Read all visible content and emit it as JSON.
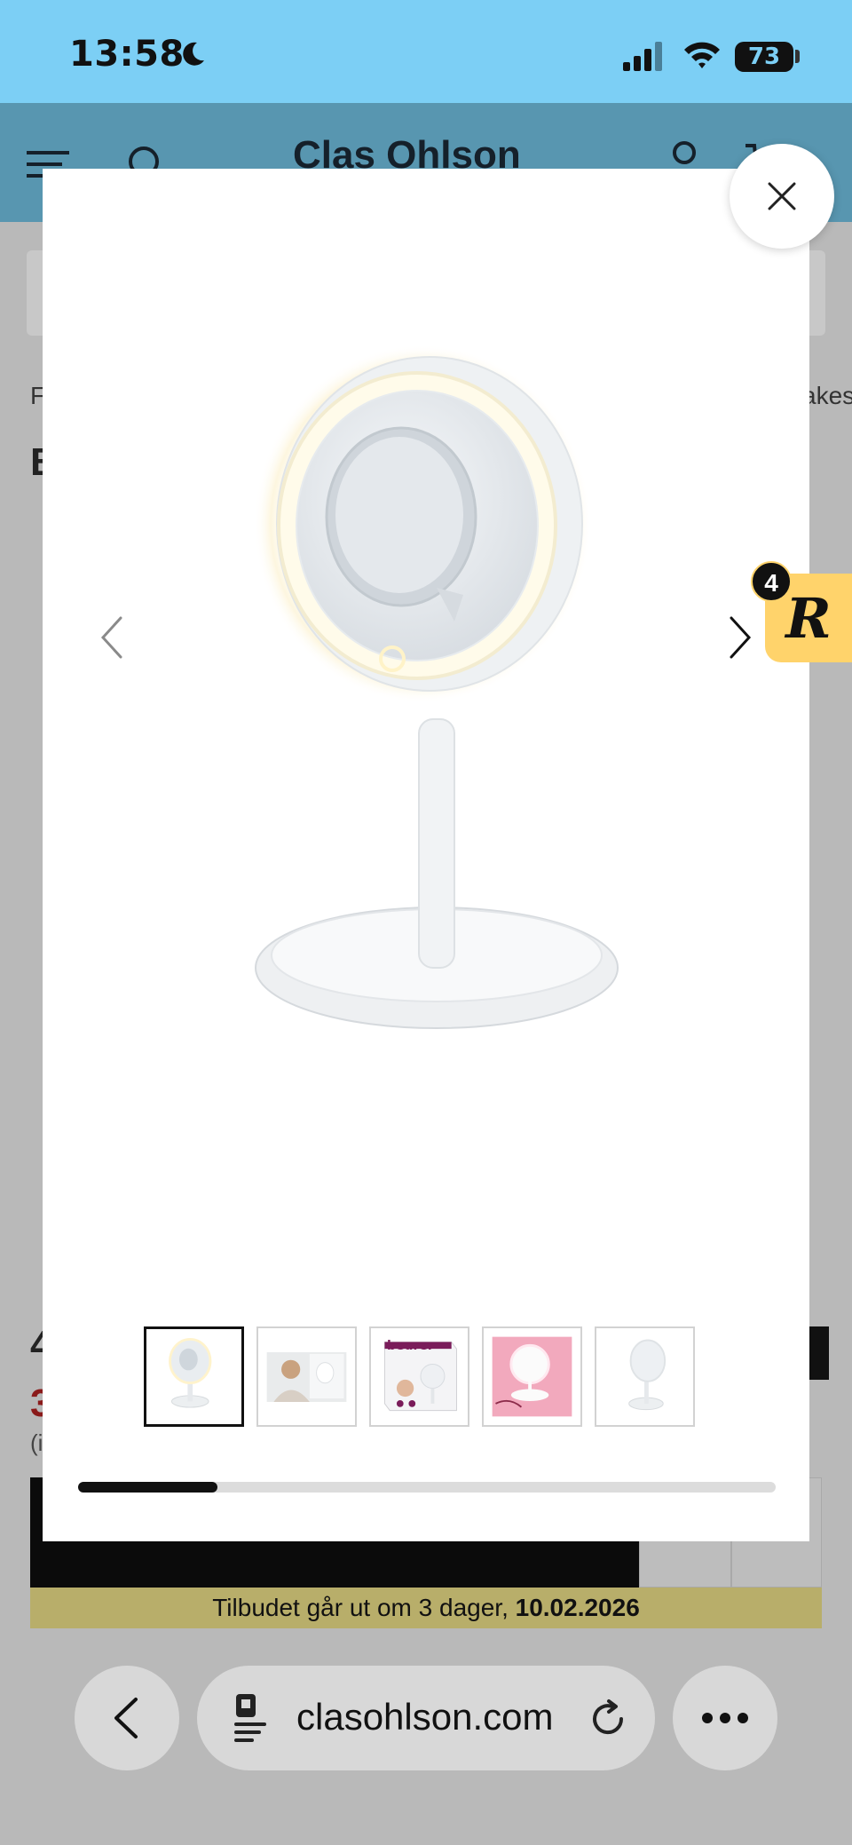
{
  "status_bar": {
    "time": "13:58",
    "battery": "73",
    "icons": [
      "moon-icon",
      "signal-icon",
      "wifi-icon",
      "battery-icon"
    ]
  },
  "header": {
    "logo_text": "Clas Ohlson",
    "icons": [
      "hamburger-icon",
      "search-icon",
      "account-icon",
      "cart-icon"
    ]
  },
  "background_page": {
    "crumb_left": "F",
    "crumb_right": "akes",
    "title_initial": "B",
    "price_initial": "4",
    "sale_initial": "3",
    "note_initial": "(i",
    "offer_text": "Tilbudet går ut om 3 dager, ",
    "offer_date": "10.02.2026"
  },
  "gallery": {
    "close_icon": "close-icon",
    "prev_icon": "chevron-left-icon",
    "next_icon": "chevron-right-icon",
    "current_index": 1,
    "thumbnails": [
      {
        "name": "thumb-mirror-front",
        "active": true
      },
      {
        "name": "thumb-woman-using-mirror",
        "active": false
      },
      {
        "name": "thumb-product-box",
        "active": false,
        "brand": "beurer"
      },
      {
        "name": "thumb-mirror-pink",
        "active": false
      },
      {
        "name": "thumb-mirror-angle",
        "active": false
      }
    ],
    "progress_fraction": 0.2
  },
  "rewards_badge": {
    "letter": "R",
    "count": "4"
  },
  "browser": {
    "url": "clasohlson.com",
    "icons": [
      "back-icon",
      "reader-icon",
      "reload-icon",
      "more-icon"
    ]
  }
}
